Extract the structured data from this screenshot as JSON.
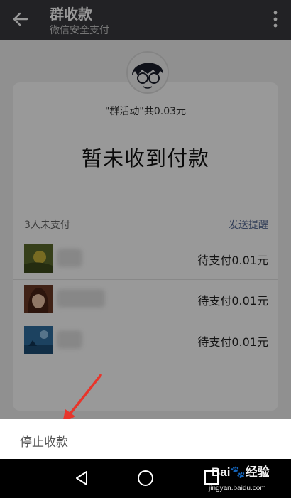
{
  "header": {
    "title": "群收款",
    "subtitle": "微信安全支付",
    "back_icon": "arrow-left-icon",
    "more_icon": "more-vertical-icon"
  },
  "summary": {
    "group_amount": "\"群活动\"共0.03元",
    "status": "暂未收到付款"
  },
  "list": {
    "unpaid_count": "3人未支付",
    "remind_label": "发送提醒",
    "rows": [
      {
        "due": "待支付0.01元"
      },
      {
        "due": "待支付0.01元"
      },
      {
        "due": "待支付0.01元"
      }
    ]
  },
  "sheet": {
    "stop_label": "停止收款"
  },
  "navbar": {
    "icons": [
      "triangle-back-icon",
      "circle-home-icon",
      "square-recent-icon"
    ]
  },
  "watermark": {
    "url": "jingyan.baidu.com"
  },
  "colors": {
    "header": "#393a3f",
    "link": "#576b95",
    "annotation_arrow": "#e8352b"
  }
}
